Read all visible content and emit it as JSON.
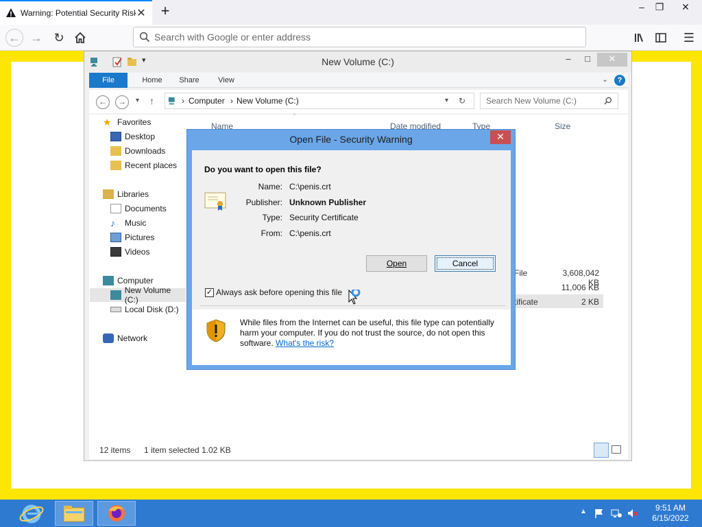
{
  "firefox": {
    "tab_title": "Warning: Potential Security Risk",
    "newtab_symbol": "+",
    "urlbar_placeholder": "Search with Google or enter address",
    "win_min": "–",
    "win_restore": "❐",
    "win_close": "✕"
  },
  "explorer": {
    "title": "New Volume (C:)",
    "ribbon_tabs": [
      "File",
      "Home",
      "Share",
      "View"
    ],
    "address": {
      "crumb1": "Computer",
      "crumb2": "New Volume (C:)"
    },
    "search_placeholder": "Search New Volume (C:)",
    "nav": {
      "favorites": "Favorites",
      "desktop": "Desktop",
      "downloads": "Downloads",
      "recent": "Recent places",
      "libraries": "Libraries",
      "documents": "Documents",
      "music": "Music",
      "pictures": "Pictures",
      "videos": "Videos",
      "computer": "Computer",
      "new_volume": "New Volume (C:)",
      "local_disk": "Local Disk (D:)",
      "network": "Network"
    },
    "columns": {
      "name": "Name",
      "date": "Date modified",
      "type": "Type",
      "size": "Size"
    },
    "rows": [
      {
        "type": "File",
        "size": "3,608,042 KB"
      },
      {
        "type": "",
        "size": "11,006 KB"
      },
      {
        "type": "tificate",
        "size": "2 KB"
      }
    ],
    "status": {
      "count": "12 items",
      "selected": "1 item selected  1.02 KB"
    }
  },
  "dialog": {
    "title": "Open File - Security Warning",
    "close": "✕",
    "question": "Do you want to open this file?",
    "name_label": "Name:",
    "name_value": "C:\\penis.crt",
    "publisher_label": "Publisher:",
    "publisher_value": "Unknown Publisher",
    "type_label": "Type:",
    "type_value": "Security Certificate",
    "from_label": "From:",
    "from_value": "C:\\penis.crt",
    "open_button": "Open",
    "cancel_button": "Cancel",
    "checkbox_label": "Always ask before opening this file",
    "checkbox_checked": true,
    "warning_text": "While files from the Internet can be useful, this file type can potentially harm your computer. If you do not trust the source, do not open this software.",
    "risk_link": "What's the risk?"
  },
  "taskbar": {
    "time": "9:51 AM",
    "date": "6/15/2022"
  }
}
